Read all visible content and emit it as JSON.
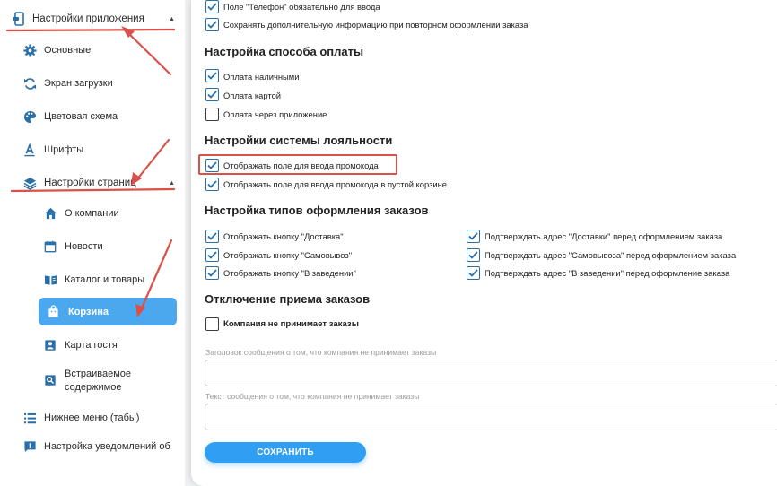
{
  "sidebar": {
    "app_settings": "Настройки приложения",
    "basic": "Основные",
    "splash": "Экран загрузки",
    "color_scheme": "Цветовая схема",
    "fonts": "Шрифты",
    "page_settings": "Настройки страниц",
    "about": "О компании",
    "news": "Новости",
    "catalog": "Каталог и товары",
    "cart": "Корзина",
    "guest_card": "Карта гостя",
    "embedded_line1": "Встраиваемое",
    "embedded_line2": "содержимое",
    "bottom_menu": "Нижнее меню (табы)",
    "notifications": "Настройка уведомлений об"
  },
  "main": {
    "phone_required": "Поле \"Телефон\" обязательно для ввода",
    "save_extra": "Сохранять дополнительную информацию при повторном оформлении заказа",
    "payment_title": "Настройка способа оплаты",
    "pay_cash": "Оплата наличными",
    "pay_card": "Оплата картой",
    "pay_app": "Оплата через приложение",
    "loyalty_title": "Настройки системы лояльности",
    "promo_field": "Отображать поле для ввода промокода",
    "promo_empty_cart": "Отображать поле для ввода промокода в пустой корзине",
    "order_types_title": "Настройка типов оформления заказов",
    "show_delivery": "Отображать кнопку \"Доставка\"",
    "show_pickup": "Отображать кнопку \"Самовывоз\"",
    "show_inhouse": "Отображать кнопку \"В заведении\"",
    "confirm_delivery": "Подтверждать адрес \"Доставки\" перед оформлением заказа",
    "confirm_pickup": "Подтверждать адрес \"Самовывоза\" перед оформлением заказа",
    "confirm_inhouse": "Подтверждать адрес \"В заведении\" перед оформление заказа",
    "disable_title": "Отключение приема заказов",
    "not_accepting": "Компания не принимает заказы",
    "header_msg_label": "Заголовок сообщения о том, что компания не принимает заказы",
    "text_msg_label": "Текст сообщения о том, что компания не принимает заказы",
    "header_msg_value": "",
    "text_msg_value": "",
    "save_button": "СОХРАНИТЬ"
  },
  "checkbox_states": {
    "phone_required": true,
    "save_extra": true,
    "pay_cash": true,
    "pay_card": true,
    "pay_app": false,
    "promo_field": true,
    "promo_empty_cart": true,
    "show_delivery": true,
    "show_pickup": true,
    "show_inhouse": true,
    "confirm_delivery": true,
    "confirm_pickup": true,
    "confirm_inhouse": true,
    "not_accepting": false
  },
  "colors": {
    "accent": "#2f9ef3",
    "active_item": "#4ba8ee",
    "annotation": "#d9514a",
    "icon_blue": "#2a6fa8"
  },
  "icons": {
    "app_settings": "app-settings-icon",
    "basic": "gear-icon",
    "splash": "refresh-icon",
    "color_scheme": "palette-icon",
    "fonts": "font-icon",
    "page_settings": "layers-icon",
    "about": "home-icon",
    "news": "calendar-icon",
    "catalog": "book-icon",
    "cart": "shopping-bag-icon",
    "guest_card": "user-card-icon",
    "embedded": "search-frame-icon",
    "bottom_menu": "list-icon",
    "notifications": "message-icon"
  }
}
